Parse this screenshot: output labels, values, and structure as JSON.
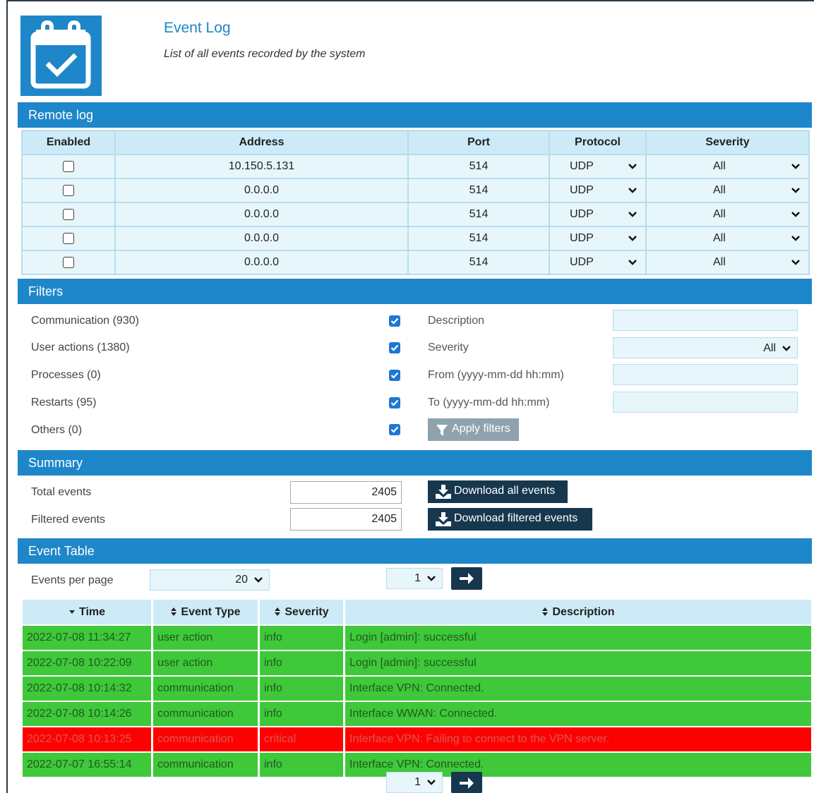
{
  "header": {
    "title": "Event Log",
    "subtitle": "List of all events recorded by the system"
  },
  "remote_log": {
    "section_title": "Remote log",
    "columns": [
      "Enabled",
      "Address",
      "Port",
      "Protocol",
      "Severity"
    ],
    "rows": [
      {
        "enabled": false,
        "address": "10.150.5.131",
        "port": "514",
        "protocol": "UDP",
        "severity": "All"
      },
      {
        "enabled": false,
        "address": "0.0.0.0",
        "port": "514",
        "protocol": "UDP",
        "severity": "All"
      },
      {
        "enabled": false,
        "address": "0.0.0.0",
        "port": "514",
        "protocol": "UDP",
        "severity": "All"
      },
      {
        "enabled": false,
        "address": "0.0.0.0",
        "port": "514",
        "protocol": "UDP",
        "severity": "All"
      },
      {
        "enabled": false,
        "address": "0.0.0.0",
        "port": "514",
        "protocol": "UDP",
        "severity": "All"
      }
    ]
  },
  "filters": {
    "section_title": "Filters",
    "categories": [
      {
        "label": "Communication (930)",
        "checked": true
      },
      {
        "label": "User actions (1380)",
        "checked": true
      },
      {
        "label": "Processes (0)",
        "checked": true
      },
      {
        "label": "Restarts (95)",
        "checked": true
      },
      {
        "label": "Others (0)",
        "checked": true
      }
    ],
    "description_label": "Description",
    "description_value": "",
    "severity_label": "Severity",
    "severity_value": "All",
    "from_label": "From (yyyy-mm-dd hh:mm)",
    "from_value": "",
    "to_label": "To (yyyy-mm-dd hh:mm)",
    "to_value": "",
    "apply_label": "Apply filters"
  },
  "summary": {
    "section_title": "Summary",
    "total_label": "Total events",
    "total_value": "2405",
    "filtered_label": "Filtered events",
    "filtered_value": "2405",
    "download_all_label": "Download all events",
    "download_filtered_label": "Download filtered events"
  },
  "event_table": {
    "section_title": "Event Table",
    "per_page_label": "Events per page",
    "per_page_value": "20",
    "page_value": "1",
    "columns": [
      "Time",
      "Event Type",
      "Severity",
      "Description"
    ],
    "rows": [
      {
        "time": "2022-07-08 11:34:27",
        "type": "user action",
        "severity": "info",
        "description": "Login [admin]: successful"
      },
      {
        "time": "2022-07-08 10:22:09",
        "type": "user action",
        "severity": "info",
        "description": "Login [admin]: successful"
      },
      {
        "time": "2022-07-08 10:14:32",
        "type": "communication",
        "severity": "info",
        "description": "Interface VPN: Connected."
      },
      {
        "time": "2022-07-08 10:14:26",
        "type": "communication",
        "severity": "info",
        "description": "Interface WWAN: Connected."
      },
      {
        "time": "2022-07-08 10:13:25",
        "type": "communication",
        "severity": "critical",
        "description": "Interface VPN: Failing to connect to the VPN server."
      },
      {
        "time": "2022-07-07 16:55:14",
        "type": "communication",
        "severity": "info",
        "description": "Interface VPN: Connected."
      }
    ]
  },
  "colors": {
    "accent": "#1e87c9",
    "dark_button": "#17374f",
    "info_row": "#3ec83a",
    "critical_row": "#ff0000"
  }
}
